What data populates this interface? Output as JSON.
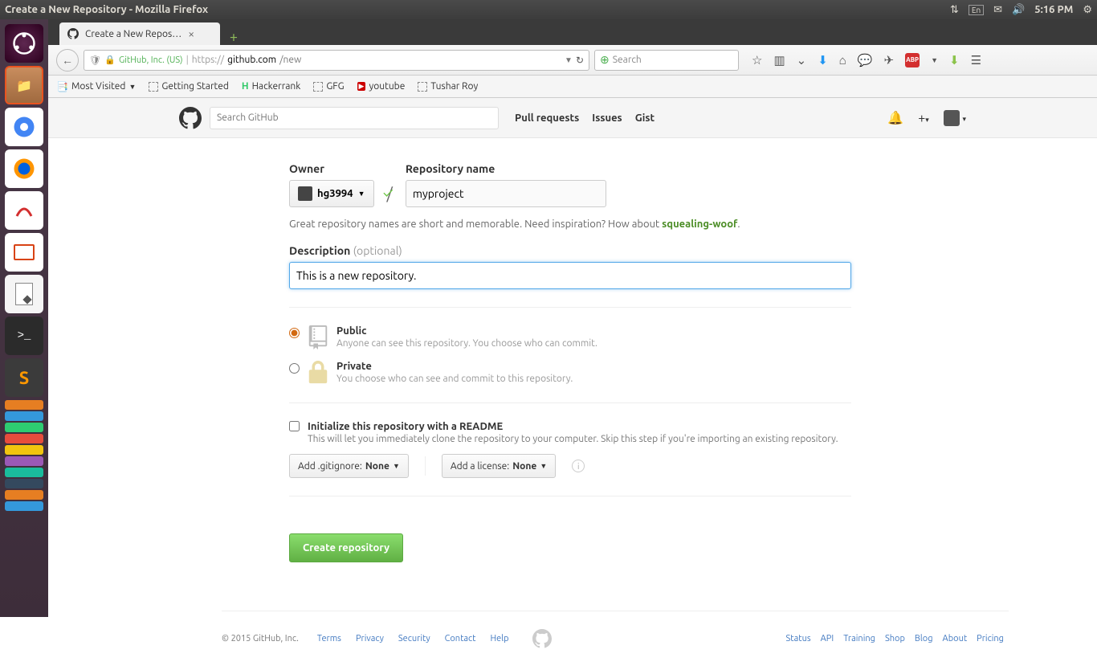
{
  "ubuntu": {
    "window_title": "Create a New Repository - Mozilla Firefox",
    "time": "5:16 PM",
    "lang": "En"
  },
  "firefox": {
    "tab_title": "Create a New Repos…",
    "identity": "GitHub, Inc. (US)",
    "url_proto": "https://",
    "url_domain": "github.com",
    "url_path": "/new",
    "search_placeholder": "Search",
    "bookmarks": [
      "Most Visited",
      "Getting Started",
      "Hackerrank",
      "GFG",
      "youtube",
      "Tushar Roy"
    ]
  },
  "github": {
    "search_placeholder": "Search GitHub",
    "nav": [
      "Pull requests",
      "Issues",
      "Gist"
    ],
    "owner_label": "Owner",
    "owner_name": "hg3994",
    "repo_label": "Repository name",
    "repo_name": "myproject",
    "hint_pre": "Great repository names are short and memorable. Need inspiration? How about ",
    "hint_suggestion": "squealing-woof",
    "desc_label": "Description",
    "desc_optional": "(optional)",
    "desc_value": "This is a new repository.",
    "public_title": "Public",
    "public_desc": "Anyone can see this repository. You choose who can commit.",
    "private_title": "Private",
    "private_desc": "You choose who can see and commit to this repository.",
    "init_title": "Initialize this repository with a README",
    "init_desc": "This will let you immediately clone the repository to your computer. Skip this step if you're importing an existing repository.",
    "gitignore_label": "Add .gitignore:",
    "gitignore_value": "None",
    "license_label": "Add a license:",
    "license_value": "None",
    "create_button": "Create repository",
    "copyright": "© 2015 GitHub, Inc.",
    "footer_left": [
      "Terms",
      "Privacy",
      "Security",
      "Contact",
      "Help"
    ],
    "footer_right": [
      "Status",
      "API",
      "Training",
      "Shop",
      "Blog",
      "About",
      "Pricing"
    ]
  }
}
